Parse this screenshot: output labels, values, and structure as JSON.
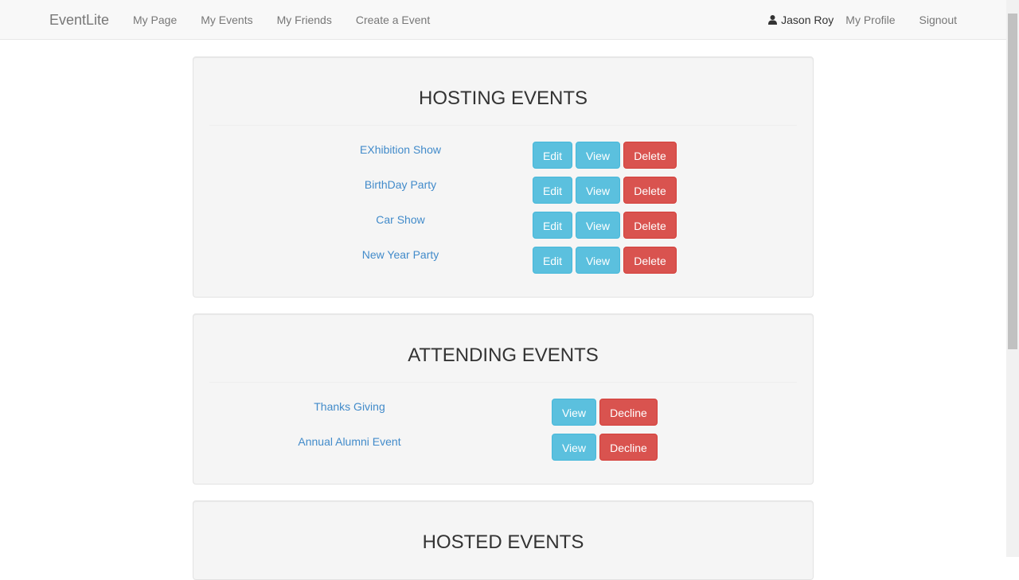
{
  "navbar": {
    "brand": "EventLite",
    "links": [
      {
        "label": "My Page"
      },
      {
        "label": "My Events"
      },
      {
        "label": "My Friends"
      },
      {
        "label": "Create a Event"
      }
    ],
    "user_name": "Jason Roy",
    "profile_label": "My Profile",
    "signout_label": "Signout"
  },
  "hosting": {
    "title": "HOSTING EVENTS",
    "edit_label": "Edit",
    "view_label": "View",
    "delete_label": "Delete",
    "events": [
      {
        "name": "EXhibition Show"
      },
      {
        "name": "BirthDay Party"
      },
      {
        "name": "Car Show"
      },
      {
        "name": "New Year Party"
      }
    ]
  },
  "attending": {
    "title": "ATTENDING EVENTS",
    "view_label": "View",
    "decline_label": "Decline",
    "events": [
      {
        "name": "Thanks Giving"
      },
      {
        "name": "Annual Alumni Event"
      }
    ]
  },
  "hosted": {
    "title": "HOSTED EVENTS"
  },
  "colors": {
    "info": "#5bc0de",
    "danger": "#d9534f",
    "link": "#428bca",
    "panel_bg": "#f5f5f5",
    "navbar_bg": "#f8f8f8"
  }
}
